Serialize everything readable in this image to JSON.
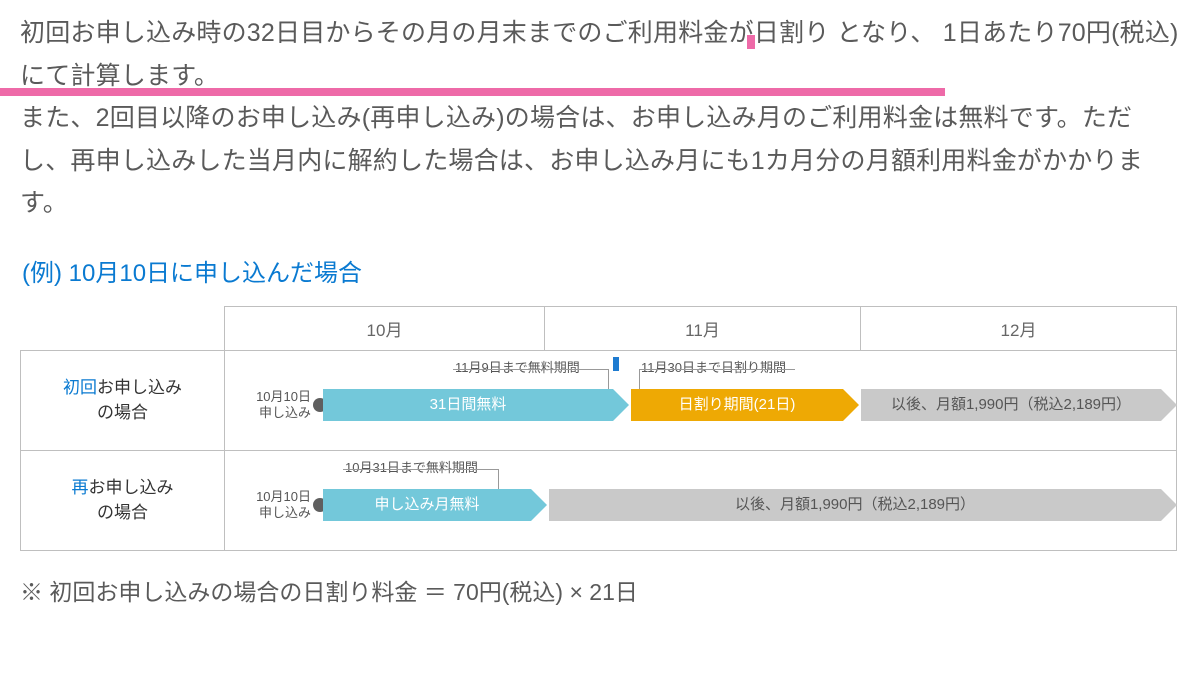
{
  "intro": {
    "line1a": "初回お申し込み時の32日目からその月の月末までのご利用料金が日割り",
    "line1b": "となり、",
    "line2": "1日あたり70円(税込)",
    "line2b": "にて計算します。",
    "para2": "また、2回目以降のお申し込み(再申し込み)の場合は、お申し込み月のご利用料金は無料です。ただし、再申し込みした当月内に解約した場合は、お申し込み月にも1カ月分の月額利用料金がかかります。"
  },
  "example_heading": "(例) 10月10日に申し込んだ場合",
  "months": {
    "m1": "10月",
    "m2": "11月",
    "m3": "12月"
  },
  "row1": {
    "head_em": "初回",
    "head_rest": "お申し込み",
    "head_line2": "の場合",
    "start_l1": "10月10日",
    "start_l2": "申し込み",
    "note_free": "11月9日まで無料期間",
    "bar_free": "31日間無料",
    "note_prorate": "11月30日まで日割り期間",
    "bar_prorate": "日割り期間(21日)",
    "bar_after": "以後、月額1,990円（税込2,189円）"
  },
  "row2": {
    "head_em": "再",
    "head_rest": "お申し込み",
    "head_line2": "の場合",
    "start_l1": "10月10日",
    "start_l2": "申し込み",
    "note_free": "10月31日まで無料期間",
    "bar_free": "申し込み月無料",
    "bar_after": "以後、月額1,990円（税込2,189円）"
  },
  "footnote": "※ 初回お申し込みの場合の日割り料金 ＝ 70円(税込) × 21日"
}
